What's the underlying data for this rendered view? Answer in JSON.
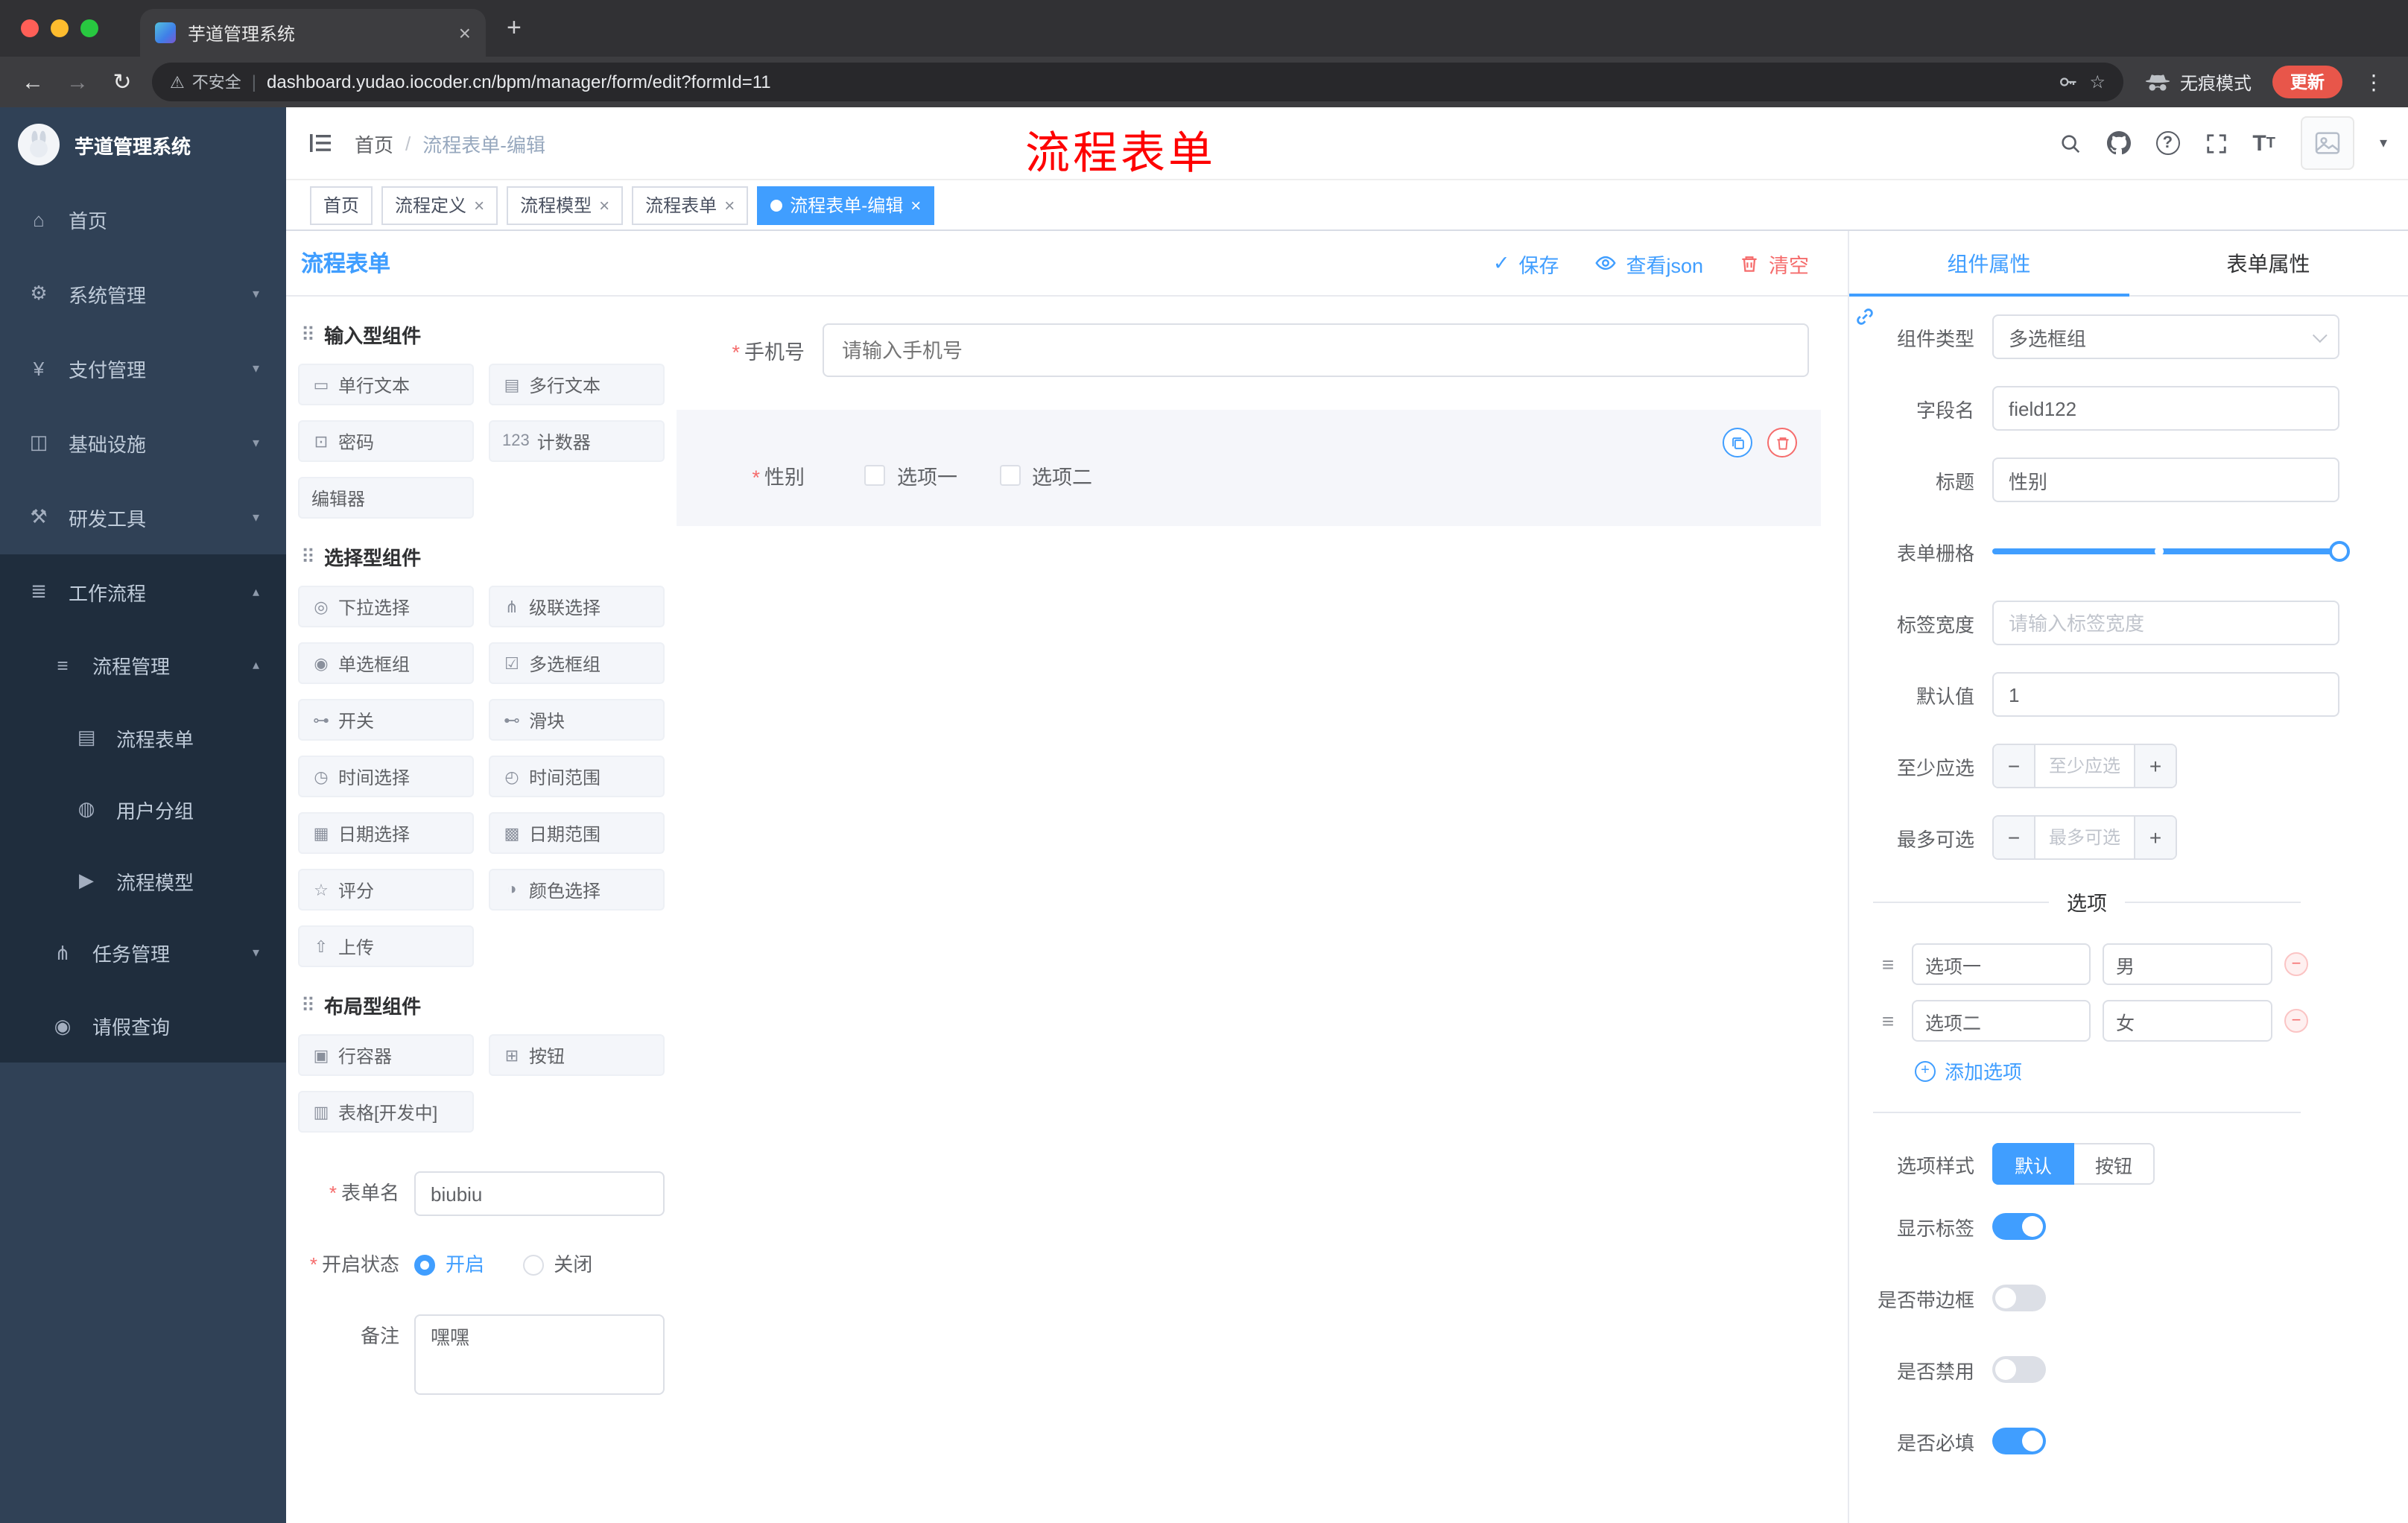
{
  "browser": {
    "tab_title": "芋道管理系统",
    "security": "不安全",
    "url": "dashboard.yudao.iocoder.cn/bpm/manager/form/edit?formId=11",
    "incognito": "无痕模式",
    "update": "更新"
  },
  "icons": {
    "back": "←",
    "forward": "→",
    "reload": "↻",
    "warning": "⚠",
    "pipe": "|",
    "star": "☆",
    "dots": "⋮",
    "new_tab": "+",
    "close": "×",
    "check": "✓",
    "qmark": "?",
    "font_big": "T",
    "font_small": "T",
    "chev_down": "▾",
    "chev_up": "▴",
    "drag": "≡",
    "minus": "−",
    "plus": "+",
    "section": "⠿"
  },
  "sidebar": {
    "brand": "芋道管理系统",
    "items": [
      {
        "icon": "⌂",
        "label": "首页"
      },
      {
        "icon": "⚙",
        "label": "系统管理"
      },
      {
        "icon": "¥",
        "label": "支付管理"
      },
      {
        "icon": "◫",
        "label": "基础设施"
      },
      {
        "icon": "⚒",
        "label": "研发工具"
      },
      {
        "icon": "≣",
        "label": "工作流程"
      }
    ],
    "submenu": {
      "process_mgmt": {
        "icon": "≡",
        "label": "流程管理",
        "children": [
          {
            "icon": "▤",
            "label": "流程表单"
          },
          {
            "icon": "◍",
            "label": "用户分组"
          },
          {
            "icon": "▶",
            "label": "流程模型"
          }
        ]
      },
      "task_mgmt": {
        "icon": "⋔",
        "label": "任务管理"
      },
      "leave_query": {
        "icon": "◉",
        "label": "请假查询"
      }
    }
  },
  "navbar": {
    "breadcrumb_home": "首页",
    "breadcrumb_sep": "/",
    "breadcrumb_current": "流程表单-编辑",
    "annotation": "流程表单"
  },
  "tags": [
    {
      "label": "首页"
    },
    {
      "label": "流程定义"
    },
    {
      "label": "流程模型"
    },
    {
      "label": "流程表单"
    },
    {
      "label": "流程表单-编辑"
    }
  ],
  "designer": {
    "title": "流程表单",
    "save": "保存",
    "view_json": "查看json",
    "clear": "清空",
    "palette": {
      "sections": [
        {
          "title": "输入型组件",
          "items": [
            {
              "g": "▭",
              "label": "单行文本"
            },
            {
              "g": "▤",
              "label": "多行文本"
            },
            {
              "g": "⊡",
              "label": "密码"
            },
            {
              "g": "123",
              "label": "计数器"
            },
            {
              "g": "",
              "label": "编辑器"
            }
          ]
        },
        {
          "title": "选择型组件",
          "items": [
            {
              "g": "◎",
              "label": "下拉选择"
            },
            {
              "g": "⋔",
              "label": "级联选择"
            },
            {
              "g": "◉",
              "label": "单选框组"
            },
            {
              "g": "☑",
              "label": "多选框组"
            },
            {
              "g": "⊶",
              "label": "开关"
            },
            {
              "g": "⊷",
              "label": "滑块"
            },
            {
              "g": "◷",
              "label": "时间选择"
            },
            {
              "g": "◴",
              "label": "时间范围"
            },
            {
              "g": "▦",
              "label": "日期选择"
            },
            {
              "g": "▩",
              "label": "日期范围"
            },
            {
              "g": "☆",
              "label": "评分"
            },
            {
              "g": "◑",
              "label": "颜色选择"
            },
            {
              "g": "⇧",
              "label": "上传"
            }
          ]
        },
        {
          "title": "布局型组件",
          "items": [
            {
              "g": "▣",
              "label": "行容器"
            },
            {
              "g": "⊞",
              "label": "按钮"
            },
            {
              "g": "▥",
              "label": "表格[开发中]"
            }
          ]
        }
      ]
    },
    "meta": {
      "name_label": "表单名",
      "name_value": "biubiu",
      "status_label": "开启状态",
      "status_on": "开启",
      "status_off": "关闭",
      "remark_label": "备注",
      "remark_value": "嘿嘿"
    },
    "canvas": {
      "phone_label": "手机号",
      "phone_placeholder": "请输入手机号",
      "gender_label": "性别",
      "options": [
        "选项一",
        "选项二"
      ]
    },
    "props": {
      "tab_component": "组件属性",
      "tab_form": "表单属性",
      "type_label": "组件类型",
      "type_value": "多选框组",
      "field_label": "字段名",
      "field_value": "field122",
      "title_label": "标题",
      "title_value": "性别",
      "grid_label": "表单栅格",
      "width_label": "标签宽度",
      "width_placeholder": "请输入标签宽度",
      "default_label": "默认值",
      "default_value": "1",
      "min_label": "至少应选",
      "min_placeholder": "至少应选",
      "max_label": "最多可选",
      "max_placeholder": "最多可选",
      "options_title": "选项",
      "options": [
        {
          "label": "选项一",
          "value": "男"
        },
        {
          "label": "选项二",
          "value": "女"
        }
      ],
      "add_option": "添加选项",
      "style_label": "选项样式",
      "style_default": "默认",
      "style_button": "按钮",
      "switches": [
        {
          "label": "显示标签",
          "on": true
        },
        {
          "label": "是否带边框",
          "on": false
        },
        {
          "label": "是否禁用",
          "on": false
        },
        {
          "label": "是否必填",
          "on": true
        }
      ]
    }
  },
  "colors": {
    "accent": "#409eff",
    "danger": "#f56c6c",
    "annotation": "#fe0000",
    "sidebar_bg": "#304156",
    "sidebar_sub_bg": "#1f2d3d",
    "active_tag": "#409eff"
  }
}
